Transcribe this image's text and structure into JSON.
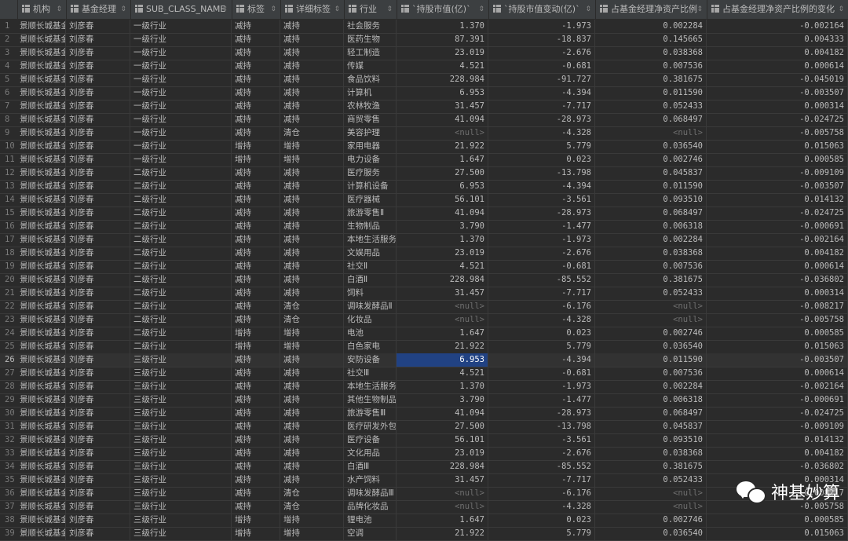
{
  "columns": [
    {
      "label": "机构",
      "type": "t"
    },
    {
      "label": "基金经理",
      "type": "t"
    },
    {
      "label": "SUB_CLASS_NAME",
      "type": "t"
    },
    {
      "label": "标签",
      "type": "t"
    },
    {
      "label": "详细标签",
      "type": "t"
    },
    {
      "label": "行业",
      "type": "t"
    },
    {
      "label": "`持股市值(亿)`",
      "type": "n"
    },
    {
      "label": "`持股市值变动(亿)`",
      "type": "n"
    },
    {
      "label": "占基金经理净资产比例",
      "type": "n"
    },
    {
      "label": "占基金经理净资产比例的变化",
      "type": "n"
    }
  ],
  "rows": [
    [
      "景顺长城基金",
      "刘彦春",
      "一级行业",
      "减持",
      "减持",
      "社会服务",
      "1.370",
      "-1.973",
      "0.002284",
      "-0.002164"
    ],
    [
      "景顺长城基金",
      "刘彦春",
      "一级行业",
      "减持",
      "减持",
      "医药生物",
      "87.391",
      "-18.837",
      "0.145665",
      "0.004333"
    ],
    [
      "景顺长城基金",
      "刘彦春",
      "一级行业",
      "减持",
      "减持",
      "轻工制造",
      "23.019",
      "-2.676",
      "0.038368",
      "0.004182"
    ],
    [
      "景顺长城基金",
      "刘彦春",
      "一级行业",
      "减持",
      "减持",
      "传媒",
      "4.521",
      "-0.681",
      "0.007536",
      "0.000614"
    ],
    [
      "景顺长城基金",
      "刘彦春",
      "一级行业",
      "减持",
      "减持",
      "食品饮料",
      "228.984",
      "-91.727",
      "0.381675",
      "-0.045019"
    ],
    [
      "景顺长城基金",
      "刘彦春",
      "一级行业",
      "减持",
      "减持",
      "计算机",
      "6.953",
      "-4.394",
      "0.011590",
      "-0.003507"
    ],
    [
      "景顺长城基金",
      "刘彦春",
      "一级行业",
      "减持",
      "减持",
      "农林牧渔",
      "31.457",
      "-7.717",
      "0.052433",
      "0.000314"
    ],
    [
      "景顺长城基金",
      "刘彦春",
      "一级行业",
      "减持",
      "减持",
      "商贸零售",
      "41.094",
      "-28.973",
      "0.068497",
      "-0.024725"
    ],
    [
      "景顺长城基金",
      "刘彦春",
      "一级行业",
      "减持",
      "清仓",
      "美容护理",
      "<null>",
      "-4.328",
      "<null>",
      "-0.005758"
    ],
    [
      "景顺长城基金",
      "刘彦春",
      "一级行业",
      "增持",
      "增持",
      "家用电器",
      "21.922",
      "5.779",
      "0.036540",
      "0.015063"
    ],
    [
      "景顺长城基金",
      "刘彦春",
      "一级行业",
      "增持",
      "增持",
      "电力设备",
      "1.647",
      "0.023",
      "0.002746",
      "0.000585"
    ],
    [
      "景顺长城基金",
      "刘彦春",
      "二级行业",
      "减持",
      "减持",
      "医疗服务",
      "27.500",
      "-13.798",
      "0.045837",
      "-0.009109"
    ],
    [
      "景顺长城基金",
      "刘彦春",
      "二级行业",
      "减持",
      "减持",
      "计算机设备",
      "6.953",
      "-4.394",
      "0.011590",
      "-0.003507"
    ],
    [
      "景顺长城基金",
      "刘彦春",
      "二级行业",
      "减持",
      "减持",
      "医疗器械",
      "56.101",
      "-3.561",
      "0.093510",
      "0.014132"
    ],
    [
      "景顺长城基金",
      "刘彦春",
      "二级行业",
      "减持",
      "减持",
      "旅游零售Ⅱ",
      "41.094",
      "-28.973",
      "0.068497",
      "-0.024725"
    ],
    [
      "景顺长城基金",
      "刘彦春",
      "二级行业",
      "减持",
      "减持",
      "生物制品",
      "3.790",
      "-1.477",
      "0.006318",
      "-0.000691"
    ],
    [
      "景顺长城基金",
      "刘彦春",
      "二级行业",
      "减持",
      "减持",
      "本地生活服务Ⅰ",
      "1.370",
      "-1.973",
      "0.002284",
      "-0.002164"
    ],
    [
      "景顺长城基金",
      "刘彦春",
      "二级行业",
      "减持",
      "减持",
      "文娱用品",
      "23.019",
      "-2.676",
      "0.038368",
      "0.004182"
    ],
    [
      "景顺长城基金",
      "刘彦春",
      "二级行业",
      "减持",
      "减持",
      "社交Ⅱ",
      "4.521",
      "-0.681",
      "0.007536",
      "0.000614"
    ],
    [
      "景顺长城基金",
      "刘彦春",
      "二级行业",
      "减持",
      "减持",
      "白酒Ⅱ",
      "228.984",
      "-85.552",
      "0.381675",
      "-0.036802"
    ],
    [
      "景顺长城基金",
      "刘彦春",
      "二级行业",
      "减持",
      "减持",
      "饲料",
      "31.457",
      "-7.717",
      "0.052433",
      "0.000314"
    ],
    [
      "景顺长城基金",
      "刘彦春",
      "二级行业",
      "减持",
      "清仓",
      "调味发酵品Ⅱ",
      "<null>",
      "-6.176",
      "<null>",
      "-0.008217"
    ],
    [
      "景顺长城基金",
      "刘彦春",
      "二级行业",
      "减持",
      "清仓",
      "化妆品",
      "<null>",
      "-4.328",
      "<null>",
      "-0.005758"
    ],
    [
      "景顺长城基金",
      "刘彦春",
      "二级行业",
      "增持",
      "增持",
      "电池",
      "1.647",
      "0.023",
      "0.002746",
      "0.000585"
    ],
    [
      "景顺长城基金",
      "刘彦春",
      "二级行业",
      "增持",
      "增持",
      "白色家电",
      "21.922",
      "5.779",
      "0.036540",
      "0.015063"
    ],
    [
      "景顺长城基金",
      "刘彦春",
      "三级行业",
      "减持",
      "减持",
      "安防设备",
      "6.953",
      "-4.394",
      "0.011590",
      "-0.003507"
    ],
    [
      "景顺长城基金",
      "刘彦春",
      "三级行业",
      "减持",
      "减持",
      "社交Ⅲ",
      "4.521",
      "-0.681",
      "0.007536",
      "0.000614"
    ],
    [
      "景顺长城基金",
      "刘彦春",
      "三级行业",
      "减持",
      "减持",
      "本地生活服务Ⅰ",
      "1.370",
      "-1.973",
      "0.002284",
      "-0.002164"
    ],
    [
      "景顺长城基金",
      "刘彦春",
      "三级行业",
      "减持",
      "减持",
      "其他生物制品",
      "3.790",
      "-1.477",
      "0.006318",
      "-0.000691"
    ],
    [
      "景顺长城基金",
      "刘彦春",
      "三级行业",
      "减持",
      "减持",
      "旅游零售Ⅲ",
      "41.094",
      "-28.973",
      "0.068497",
      "-0.024725"
    ],
    [
      "景顺长城基金",
      "刘彦春",
      "三级行业",
      "减持",
      "减持",
      "医疗研发外包",
      "27.500",
      "-13.798",
      "0.045837",
      "-0.009109"
    ],
    [
      "景顺长城基金",
      "刘彦春",
      "三级行业",
      "减持",
      "减持",
      "医疗设备",
      "56.101",
      "-3.561",
      "0.093510",
      "0.014132"
    ],
    [
      "景顺长城基金",
      "刘彦春",
      "三级行业",
      "减持",
      "减持",
      "文化用品",
      "23.019",
      "-2.676",
      "0.038368",
      "0.004182"
    ],
    [
      "景顺长城基金",
      "刘彦春",
      "三级行业",
      "减持",
      "减持",
      "白酒Ⅲ",
      "228.984",
      "-85.552",
      "0.381675",
      "-0.036802"
    ],
    [
      "景顺长城基金",
      "刘彦春",
      "三级行业",
      "减持",
      "减持",
      "水产饲料",
      "31.457",
      "-7.717",
      "0.052433",
      "0.000314"
    ],
    [
      "景顺长城基金",
      "刘彦春",
      "三级行业",
      "减持",
      "清仓",
      "调味发酵品Ⅲ",
      "<null>",
      "-6.176",
      "<null>",
      "-0.008217"
    ],
    [
      "景顺长城基金",
      "刘彦春",
      "三级行业",
      "减持",
      "清仓",
      "品牌化妆品",
      "<null>",
      "-4.328",
      "<null>",
      "-0.005758"
    ],
    [
      "景顺长城基金",
      "刘彦春",
      "三级行业",
      "增持",
      "增持",
      "锂电池",
      "1.647",
      "0.023",
      "0.002746",
      "0.000585"
    ],
    [
      "景顺长城基金",
      "刘彦春",
      "三级行业",
      "增持",
      "增持",
      "空调",
      "21.922",
      "5.779",
      "0.036540",
      "0.015063"
    ]
  ],
  "selected_row": 26,
  "highlight_cell": {
    "row": 26,
    "col": 6
  },
  "watermark": {
    "text": "神基妙算",
    "icon": "wechat-icon"
  },
  "colors": {
    "background": "#2b2b2b",
    "header": "#3c3f41",
    "selection": "#214283",
    "null": "#6f6f6f"
  }
}
